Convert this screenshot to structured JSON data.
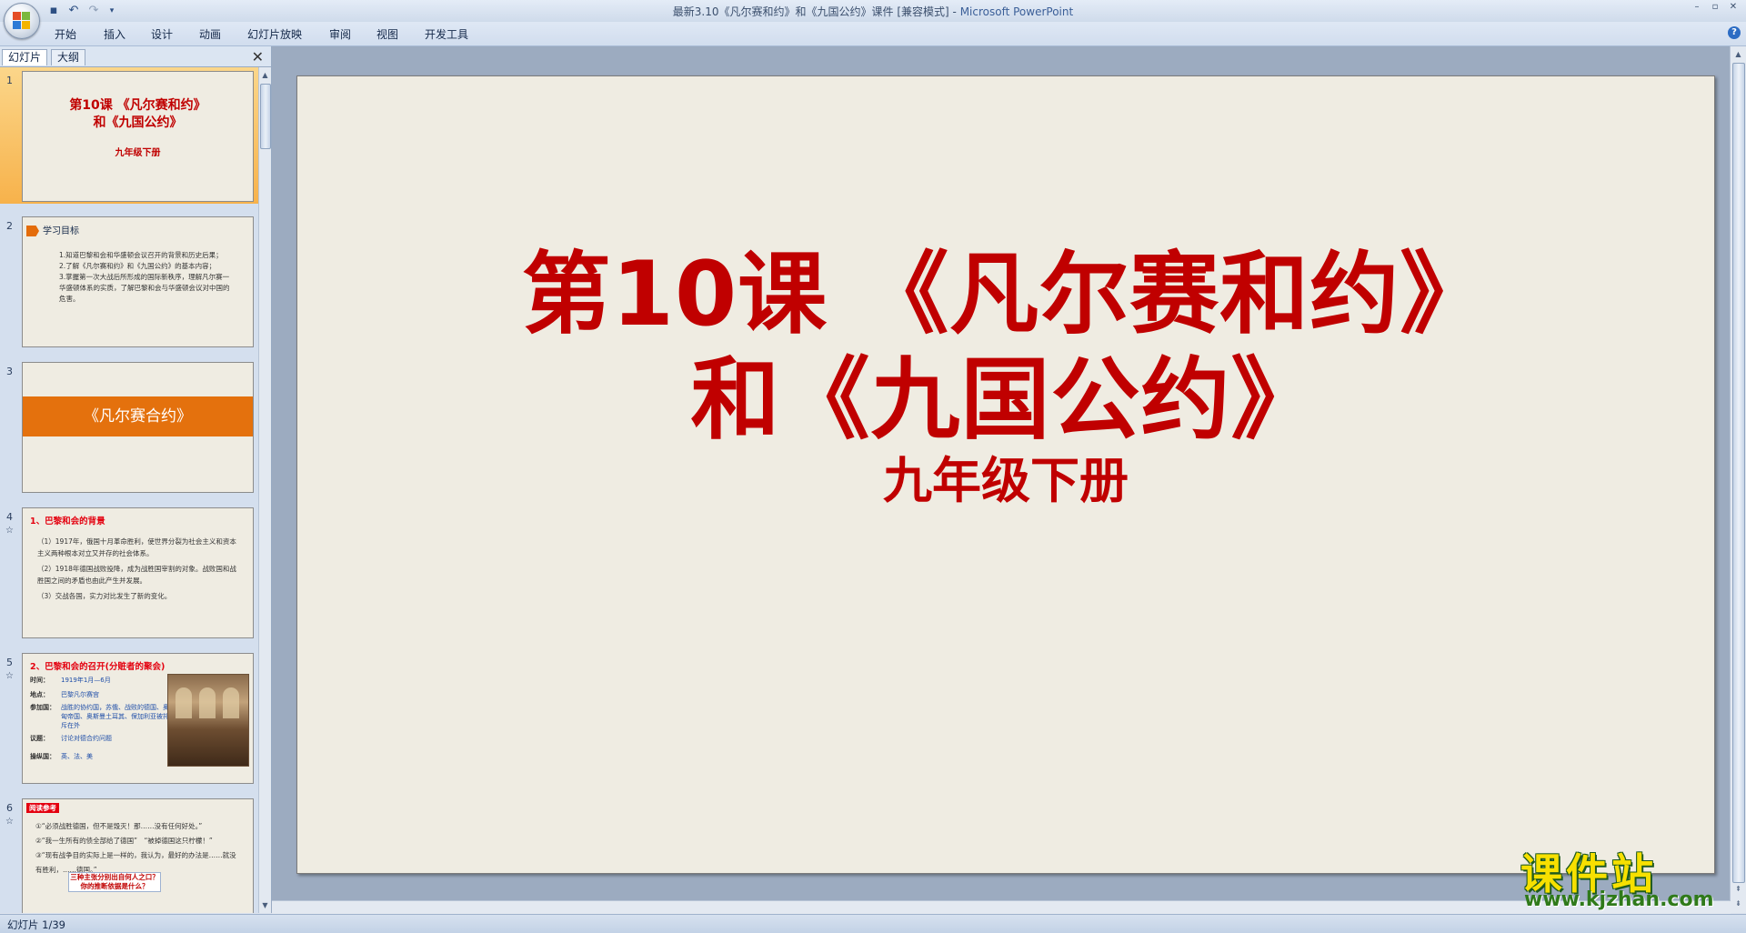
{
  "window": {
    "title": "最新3.10《凡尔赛和约》和《九国公约》课件 [兼容模式]",
    "app_name": "Microsoft PowerPoint"
  },
  "ribbon": {
    "tabs": [
      "开始",
      "插入",
      "设计",
      "动画",
      "幻灯片放映",
      "审阅",
      "视图",
      "开发工具"
    ]
  },
  "left_pane": {
    "tabs": [
      "幻灯片",
      "大纲"
    ],
    "slides": [
      {
        "number": "1",
        "title_line1": "第10课 《凡尔赛和约》",
        "title_line2": "和《九国公约》",
        "subtitle": "九年级下册"
      },
      {
        "number": "2",
        "heading": "学习目标",
        "lines": [
          "1.知道巴黎和会和华盛顿会议召开的背景和历史后果；",
          "2.了解《凡尔赛和约》和《九国公约》的基本内容；",
          "3.掌握第一次大战后所形成的国际新秩序，理解凡尔赛一华盛顿体系的实质，了解巴黎和会与华盛顿会议对中国的危害。"
        ]
      },
      {
        "number": "3",
        "band": "《凡尔赛合约》"
      },
      {
        "number": "4",
        "star": "☆",
        "heading": "1、巴黎和会的背景",
        "lines": [
          "（1）1917年，俄国十月革命胜利，使世界分裂为社会主义和资本主义两种根本对立又并存的社会体系。",
          "（2）1918年德国战败投降，成为战胜国宰割的对象。战败国和战胜国之间的矛盾也由此产生并发展。",
          "（3）交战各国，实力对比发生了新的变化。"
        ]
      },
      {
        "number": "5",
        "star": "☆",
        "heading": "2、巴黎和会的召开(分赃者的聚会)",
        "rows": [
          {
            "k": "时间：",
            "v": "1919年1月—6月"
          },
          {
            "k": "地点：",
            "v": "巴黎凡尔赛宫"
          },
          {
            "k": "参加国：",
            "v": "战胜的协约国，苏俄、战败的德国、奥匈帝国、奥斯曼土耳其、保加利亚被排斥在外"
          },
          {
            "k": "议题：",
            "v": "讨论对德合约问题"
          },
          {
            "k": "操纵国：",
            "v": "英、法、美"
          }
        ]
      },
      {
        "number": "6",
        "star": "☆",
        "badge": "阅读参考",
        "lines": [
          "①“必须战胜德国，但不是毁灭！那……没有任何好处。”",
          "②“我一生所有的债全部给了德国”　“被掉德国这只柠檬！”",
          "③“现有战争目的实际上是一样的，我认为，最好的办法是……就没有胜利，……德国。”"
        ],
        "box": "三种主张分别出自何人之口？你的推断依据是什么？"
      }
    ]
  },
  "slide": {
    "title_line1": "第10课 《凡尔赛和约》",
    "title_line2": "和《九国公约》",
    "subtitle": "九年级下册"
  },
  "status_bar": {
    "text": "幻灯片 1/39"
  },
  "watermark": {
    "main": "课件站",
    "url": "www.kjzhan.com"
  },
  "colors": {
    "title_red": "#c00000",
    "accent_orange": "#e4710d",
    "slide_bg": "#efece2"
  }
}
